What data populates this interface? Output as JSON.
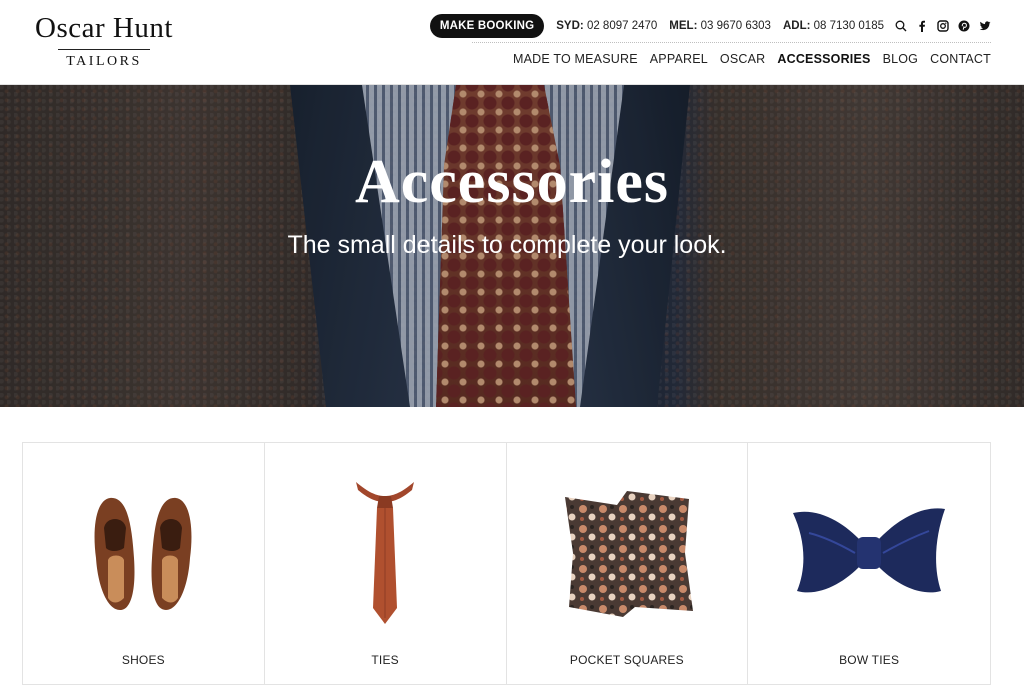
{
  "brand": {
    "name": "Oscar Hunt",
    "subtitle": "TAILORS"
  },
  "topbar": {
    "booking_label": "MAKE BOOKING",
    "phones": [
      {
        "city": "SYD:",
        "number": "02 8097 2470"
      },
      {
        "city": "MEL:",
        "number": "03 9670 6303"
      },
      {
        "city": "ADL:",
        "number": "08 7130 0185"
      }
    ],
    "icons": [
      "search-icon",
      "facebook-icon",
      "instagram-icon",
      "pinterest-icon",
      "twitter-icon"
    ]
  },
  "nav": {
    "items": [
      "MADE TO MEASURE",
      "APPAREL",
      "OSCAR",
      "ACCESSORIES",
      "BLOG",
      "CONTACT"
    ],
    "active": "ACCESSORIES"
  },
  "hero": {
    "title": "Accessories",
    "subtitle": "The small details to complete your look."
  },
  "categories": [
    {
      "label": "SHOES",
      "image": "shoes-image"
    },
    {
      "label": "TIES",
      "image": "tie-image"
    },
    {
      "label": "POCKET SQUARES",
      "image": "pocket-square-image"
    },
    {
      "label": "BOW TIES",
      "image": "bow-tie-image"
    }
  ]
}
